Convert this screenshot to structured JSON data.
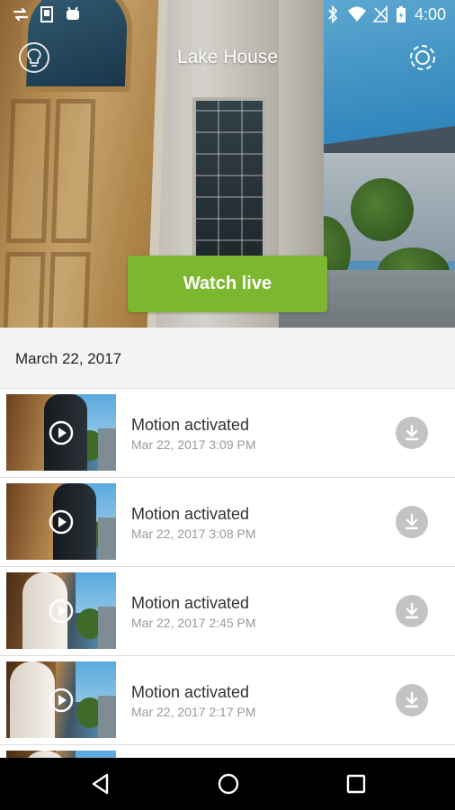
{
  "status_bar": {
    "time": "4:00",
    "icons": [
      "sync-icon",
      "sd-card-icon",
      "android-icon",
      "bluetooth-icon",
      "wifi-icon",
      "no-signal-icon",
      "battery-charging-icon"
    ]
  },
  "header": {
    "title": "Lake House",
    "left_icon": "lightbulb-icon",
    "right_icon": "gear-icon"
  },
  "watch_live": {
    "label": "Watch live"
  },
  "date_header": {
    "label": "March 22, 2017"
  },
  "events": [
    {
      "title": "Motion activated",
      "timestamp": "Mar 22, 2017 3:09 PM"
    },
    {
      "title": "Motion activated",
      "timestamp": "Mar 22, 2017 3:08 PM"
    },
    {
      "title": "Motion activated",
      "timestamp": "Mar 22, 2017 2:45 PM"
    },
    {
      "title": "Motion activated",
      "timestamp": "Mar 22, 2017 2:17 PM"
    }
  ],
  "colors": {
    "accent_green": "#7cb82f",
    "download_icon_bg": "#c3c3c3",
    "date_header_bg": "#f4f4f4"
  }
}
